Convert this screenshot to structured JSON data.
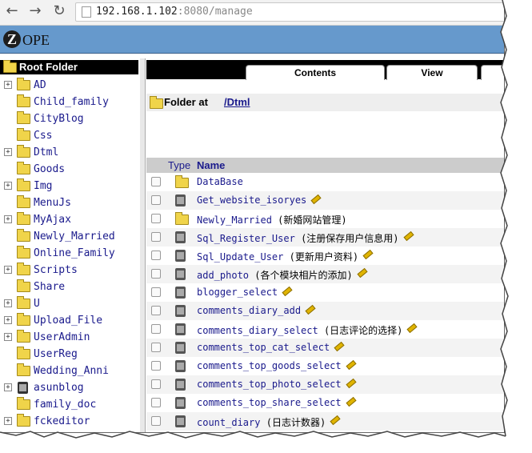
{
  "browser": {
    "back_icon": "←",
    "forward_icon": "→",
    "reload_icon": "↻",
    "url_host": "192.168.1.102",
    "url_rest": ":8080/manage"
  },
  "header": {
    "logo_letter": "Z",
    "logo_text": "OPE"
  },
  "tree": {
    "root_label": "Root Folder",
    "items": [
      {
        "label": "AD",
        "expandable": true,
        "icon": "folder-icon"
      },
      {
        "label": "Child_family",
        "expandable": false,
        "icon": "folder-icon"
      },
      {
        "label": "CityBlog",
        "expandable": false,
        "icon": "folder-icon"
      },
      {
        "label": "Css",
        "expandable": false,
        "icon": "folder-icon"
      },
      {
        "label": "Dtml",
        "expandable": true,
        "icon": "folder-icon"
      },
      {
        "label": "Goods",
        "expandable": false,
        "icon": "folder-icon"
      },
      {
        "label": "Img",
        "expandable": true,
        "icon": "folder-icon"
      },
      {
        "label": "MenuJs",
        "expandable": false,
        "icon": "folder-icon"
      },
      {
        "label": "MyAjax",
        "expandable": true,
        "icon": "folder-icon"
      },
      {
        "label": "Newly_Married",
        "expandable": false,
        "icon": "folder-icon"
      },
      {
        "label": "Online_Family",
        "expandable": false,
        "icon": "folder-icon"
      },
      {
        "label": "Scripts",
        "expandable": true,
        "icon": "folder-icon"
      },
      {
        "label": "Share",
        "expandable": false,
        "icon": "folder-icon"
      },
      {
        "label": "U",
        "expandable": true,
        "icon": "folder-icon"
      },
      {
        "label": "Upload_File",
        "expandable": true,
        "icon": "folder-icon"
      },
      {
        "label": "UserAdmin",
        "expandable": true,
        "icon": "folder-icon"
      },
      {
        "label": "UserReg",
        "expandable": false,
        "icon": "folder-icon"
      },
      {
        "label": "Wedding_Anni",
        "expandable": false,
        "icon": "folder-icon"
      },
      {
        "label": "asunblog",
        "expandable": true,
        "icon": "blog-icon"
      },
      {
        "label": "family_doc",
        "expandable": false,
        "icon": "folder-icon"
      },
      {
        "label": "fckeditor",
        "expandable": true,
        "icon": "folder-icon"
      }
    ]
  },
  "tabs": [
    {
      "label": "Contents"
    },
    {
      "label": "View"
    }
  ],
  "location": {
    "label": "Folder at",
    "path": "/Dtml"
  },
  "table": {
    "col_type": "Type",
    "col_name": "Name",
    "rows": [
      {
        "name": "DataBase",
        "note": "",
        "icon": "folder-icon",
        "locked": false
      },
      {
        "name": "Get_website_isoryes",
        "note": "",
        "icon": "db-method-icon",
        "locked": true
      },
      {
        "name": "Newly_Married",
        "note": "(新婚网站管理)",
        "icon": "folder-icon",
        "locked": false
      },
      {
        "name": "Sql_Register_User",
        "note": "(注册保存用户信息用)",
        "icon": "db-method-icon",
        "locked": true
      },
      {
        "name": "Sql_Update_User",
        "note": "(更新用户资料)",
        "icon": "db-method-icon",
        "locked": true
      },
      {
        "name": "add_photo",
        "note": "(各个模块相片的添加)",
        "icon": "db-method-icon",
        "locked": true
      },
      {
        "name": "blogger_select",
        "note": "",
        "icon": "db-method-icon",
        "locked": true
      },
      {
        "name": "comments_diary_add",
        "note": "",
        "icon": "db-method-icon",
        "locked": true
      },
      {
        "name": "comments_diary_select",
        "note": "(日志评论的选择)",
        "icon": "db-method-icon",
        "locked": true
      },
      {
        "name": "comments_top_cat_select",
        "note": "",
        "icon": "db-method-icon",
        "locked": true
      },
      {
        "name": "comments_top_goods_select",
        "note": "",
        "icon": "db-method-icon",
        "locked": true
      },
      {
        "name": "comments_top_photo_select",
        "note": "",
        "icon": "db-method-icon",
        "locked": true
      },
      {
        "name": "comments_top_share_select",
        "note": "",
        "icon": "db-method-icon",
        "locked": true
      },
      {
        "name": "count_diary",
        "note": "(日志计数器)",
        "icon": "db-method-icon",
        "locked": true
      }
    ]
  }
}
